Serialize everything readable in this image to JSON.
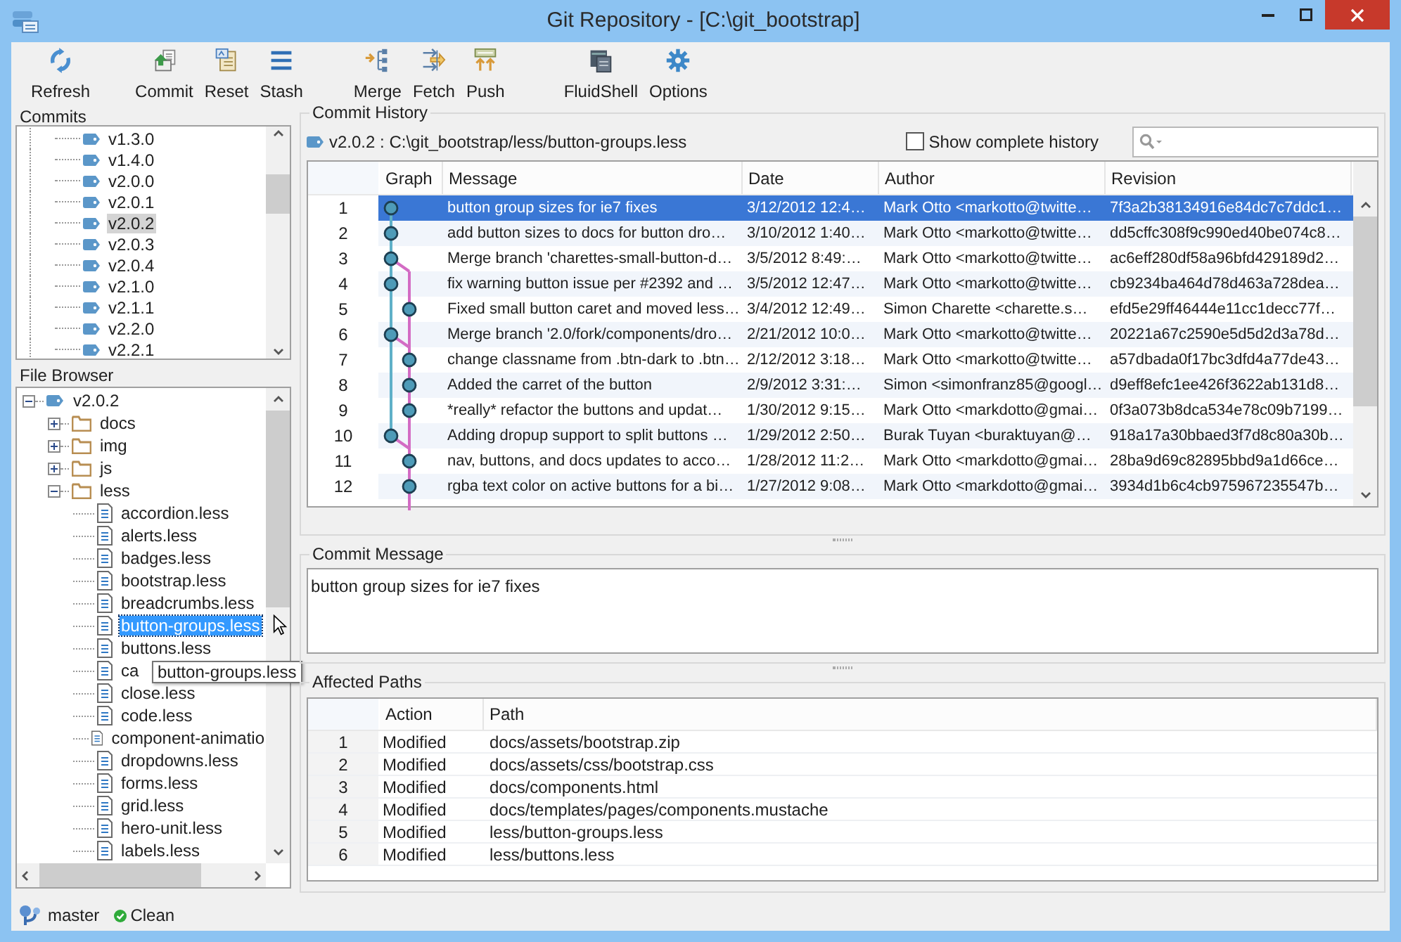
{
  "window": {
    "title": "Git Repository - [C:\\git_bootstrap]"
  },
  "toolbar_groups": [
    [
      {
        "label": "Refresh",
        "kind": "refresh"
      }
    ],
    [
      {
        "label": "Commit",
        "kind": "commit"
      },
      {
        "label": "Reset",
        "kind": "reset"
      },
      {
        "label": "Stash",
        "kind": "stash"
      }
    ],
    [
      {
        "label": "Merge",
        "kind": "merge"
      },
      {
        "label": "Fetch",
        "kind": "fetch"
      },
      {
        "label": "Push",
        "kind": "push"
      }
    ],
    [
      {
        "label": "FluidShell",
        "kind": "shell"
      },
      {
        "label": "Options",
        "kind": "options"
      }
    ]
  ],
  "commits_panel": {
    "title": "Commits",
    "items": [
      {
        "label": "v1.3.0",
        "selected": false
      },
      {
        "label": "v1.4.0",
        "selected": false
      },
      {
        "label": "v2.0.0",
        "selected": false
      },
      {
        "label": "v2.0.1",
        "selected": false
      },
      {
        "label": "v2.0.2",
        "selected": true
      },
      {
        "label": "v2.0.3",
        "selected": false
      },
      {
        "label": "v2.0.4",
        "selected": false
      },
      {
        "label": "v2.1.0",
        "selected": false
      },
      {
        "label": "v2.1.1",
        "selected": false
      },
      {
        "label": "v2.2.0",
        "selected": false
      },
      {
        "label": "v2.2.1",
        "selected": false
      }
    ]
  },
  "file_browser": {
    "title": "File Browser",
    "tree": [
      {
        "label": "v2.0.2",
        "kind": "tag",
        "expanded": true,
        "selected": false,
        "children": [
          {
            "label": "docs",
            "kind": "folder",
            "expanded": false,
            "selected": false
          },
          {
            "label": "img",
            "kind": "folder",
            "expanded": false,
            "selected": false
          },
          {
            "label": "js",
            "kind": "folder",
            "expanded": false,
            "selected": false
          },
          {
            "label": "less",
            "kind": "folder",
            "expanded": true,
            "selected": false,
            "children": [
              {
                "label": "accordion.less",
                "kind": "file",
                "selected": false
              },
              {
                "label": "alerts.less",
                "kind": "file",
                "selected": false
              },
              {
                "label": "badges.less",
                "kind": "file",
                "selected": false
              },
              {
                "label": "bootstrap.less",
                "kind": "file",
                "selected": false
              },
              {
                "label": "breadcrumbs.less",
                "kind": "file",
                "selected": false
              },
              {
                "label": "button-groups.less",
                "kind": "file",
                "selected": true
              },
              {
                "label": "buttons.less",
                "kind": "file",
                "selected": false
              },
              {
                "label": "ca",
                "kind": "file",
                "selected": false
              },
              {
                "label": "close.less",
                "kind": "file",
                "selected": false
              },
              {
                "label": "code.less",
                "kind": "file",
                "selected": false
              },
              {
                "label": "component-animatio",
                "kind": "file",
                "selected": false
              },
              {
                "label": "dropdowns.less",
                "kind": "file",
                "selected": false
              },
              {
                "label": "forms.less",
                "kind": "file",
                "selected": false
              },
              {
                "label": "grid.less",
                "kind": "file",
                "selected": false
              },
              {
                "label": "hero-unit.less",
                "kind": "file",
                "selected": false
              },
              {
                "label": "labels.less",
                "kind": "file",
                "selected": false
              }
            ]
          }
        ]
      }
    ],
    "tooltip": "button-groups.less"
  },
  "commit_history": {
    "title": "Commit History",
    "path": "v2.0.2 : C:\\git_bootstrap/less/button-groups.less",
    "show_complete_history": {
      "label": "Show complete history",
      "checked": false
    },
    "columns": [
      "Graph",
      "Message",
      "Date",
      "Author",
      "Revision"
    ],
    "rows": [
      {
        "number": "1",
        "kind": "main",
        "merge": false,
        "selected": true,
        "message": "button group sizes for ie7 fixes",
        "date": "3/12/2012 12:4…",
        "author": "Mark Otto <markotto@twitte…",
        "revision": "7f3a2b38134916e84dc7c7ddc1…"
      },
      {
        "number": "2",
        "kind": "main",
        "merge": false,
        "selected": false,
        "message": "add button sizes to docs for button dro…",
        "date": "3/10/2012 1:40…",
        "author": "Mark Otto <markotto@twitte…",
        "revision": "dd5cffc308f9c990ed40be074c8…"
      },
      {
        "number": "3",
        "kind": "main",
        "merge": true,
        "selected": false,
        "message": "Merge branch 'charettes-small-button-d…",
        "date": "3/5/2012 8:49:…",
        "author": "Mark Otto <markotto@twitte…",
        "revision": "ac6eff280df58a96bfd429189d2…"
      },
      {
        "number": "4",
        "kind": "main",
        "merge": false,
        "selected": false,
        "message": "fix warning button issue per #2392 and …",
        "date": "3/5/2012 12:47…",
        "author": "Mark Otto <markotto@twitte…",
        "revision": "cb9234ba464d78d463a728dea…"
      },
      {
        "number": "5",
        "kind": "branch",
        "merge": false,
        "selected": false,
        "message": "Fixed small button caret and moved less…",
        "date": "3/4/2012 12:49…",
        "author": "Simon Charette <charette.s…",
        "revision": "efd5e29ff46444e11cc1decc77f…"
      },
      {
        "number": "6",
        "kind": "main",
        "merge": true,
        "selected": false,
        "message": "Merge branch '2.0/fork/components/dro…",
        "date": "2/21/2012 10:0…",
        "author": "Mark Otto <markotto@twitte…",
        "revision": "20221a67c2590e5d5d2d3a78d…"
      },
      {
        "number": "7",
        "kind": "branch",
        "merge": false,
        "selected": false,
        "message": "change classname from .btn-dark to .btn…",
        "date": "2/12/2012 3:18…",
        "author": "Mark Otto <markotto@twitte…",
        "revision": "a57dbada0f17bc3dfd4a77de43…"
      },
      {
        "number": "8",
        "kind": "branch",
        "merge": false,
        "selected": false,
        "message": "Added the carret of the button",
        "date": "2/9/2012 3:31:…",
        "author": "Simon <simonfranz85@googl…",
        "revision": "d9eff8efc1ee426f3622ab131d8…"
      },
      {
        "number": "9",
        "kind": "branch",
        "merge": false,
        "selected": false,
        "message": "*really* refactor the buttons and updat…",
        "date": "1/30/2012 9:15…",
        "author": "Mark Otto <markdotto@gmai…",
        "revision": "0f3a073b8dca534e78c09b7199…"
      },
      {
        "number": "10",
        "kind": "main",
        "merge": true,
        "selected": false,
        "message": "Adding dropup support to split buttons …",
        "date": "1/29/2012 2:50…",
        "author": "Burak Tuyan <buraktuyan@…",
        "revision": "918a17a30bbaed3f7d8c80a30b…"
      },
      {
        "number": "11",
        "kind": "branch",
        "merge": false,
        "selected": false,
        "message": "nav, buttons, and docs updates to acco…",
        "date": "1/28/2012 11:2…",
        "author": "Mark Otto <markdotto@gmai…",
        "revision": "28ba9d69c82895bbd9a1d66ce…"
      },
      {
        "number": "12",
        "kind": "branch",
        "merge": false,
        "selected": false,
        "message": "rgba text color on active buttons for a bi…",
        "date": "1/27/2012 9:08…",
        "author": "Mark Otto <markdotto@gmai…",
        "revision": "3934d1b6c4cb975967235547b…"
      }
    ]
  },
  "commit_message": {
    "title": "Commit Message",
    "text": "button group sizes for ie7 fixes"
  },
  "affected_paths": {
    "title": "Affected Paths",
    "columns": [
      "Action",
      "Path"
    ],
    "rows": [
      {
        "number": "1",
        "action": "Modified",
        "path": "docs/assets/bootstrap.zip"
      },
      {
        "number": "2",
        "action": "Modified",
        "path": "docs/assets/css/bootstrap.css"
      },
      {
        "number": "3",
        "action": "Modified",
        "path": "docs/components.html"
      },
      {
        "number": "4",
        "action": "Modified",
        "path": "docs/templates/pages/components.mustache"
      },
      {
        "number": "5",
        "action": "Modified",
        "path": "less/button-groups.less"
      },
      {
        "number": "6",
        "action": "Modified",
        "path": "less/buttons.less"
      }
    ]
  },
  "status_bar": {
    "branch": "master",
    "state": "Clean"
  }
}
